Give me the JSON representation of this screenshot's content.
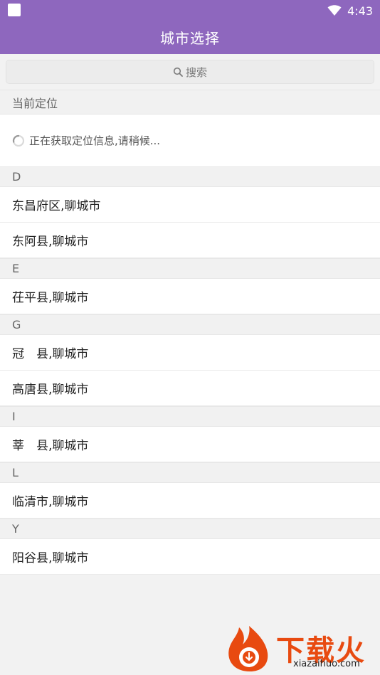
{
  "status_bar": {
    "time": "4:43",
    "icons": [
      "square-icon",
      "wifi-icon"
    ]
  },
  "header": {
    "title": "城市选择"
  },
  "search": {
    "placeholder": "搜索",
    "icon": "search-icon"
  },
  "current_location": {
    "header": "当前定位",
    "status_text": "正在获取定位信息,请稍候...",
    "icon": "loading-spinner-icon"
  },
  "sections": [
    {
      "letter": "D",
      "cities": [
        "东昌府区,聊城市",
        "东阿县,聊城市"
      ]
    },
    {
      "letter": "E",
      "cities": [
        "茌平县,聊城市"
      ]
    },
    {
      "letter": "G",
      "cities": [
        "冠　县,聊城市",
        "高唐县,聊城市"
      ]
    },
    {
      "letter": "I",
      "cities": [
        "莘　县,聊城市"
      ]
    },
    {
      "letter": "L",
      "cities": [
        "临清市,聊城市"
      ]
    },
    {
      "letter": "Y",
      "cities": [
        "阳谷县,聊城市"
      ]
    }
  ],
  "watermark": {
    "brand": "下载火",
    "url": "xiazaihuo.com",
    "color": "#e84a10"
  },
  "colors": {
    "primary": "#8e67be",
    "background": "#f2f2f2"
  }
}
